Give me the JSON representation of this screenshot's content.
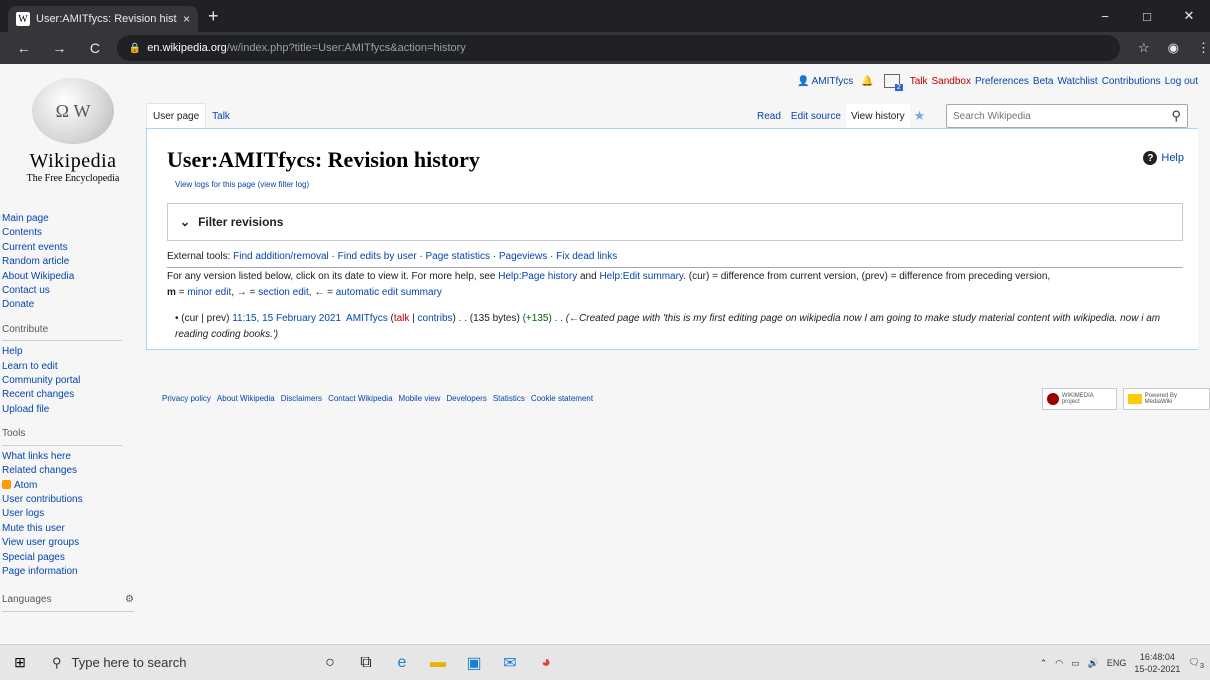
{
  "browser": {
    "tab_title": "User:AMITfycs: Revision history -",
    "tab_close": "×",
    "new_tab": "+",
    "url_host": "en.wikipedia.org",
    "url_path": "/w/index.php?title=User:AMITfycs&action=history",
    "win_minimize": "−",
    "win_restore": "□",
    "win_close": "✕"
  },
  "logo": {
    "wordmark": "Wikipedia",
    "tagline": "The Free Encyclopedia"
  },
  "personal": {
    "username": "AMITfycs",
    "notif_count": "2",
    "links": [
      "Talk",
      "Sandbox",
      "Preferences",
      "Beta",
      "Watchlist",
      "Contributions",
      "Log out"
    ]
  },
  "tabs": {
    "user_page": "User page",
    "talk": "Talk",
    "read": "Read",
    "edit_source": "Edit source",
    "view_history": "View history"
  },
  "search": {
    "placeholder": "Search Wikipedia"
  },
  "sidebar": {
    "nav": [
      "Main page",
      "Contents",
      "Current events",
      "Random article",
      "About Wikipedia",
      "Contact us",
      "Donate"
    ],
    "contribute_heading": "Contribute",
    "contribute": [
      "Help",
      "Learn to edit",
      "Community portal",
      "Recent changes",
      "Upload file"
    ],
    "tools_heading": "Tools",
    "tools": [
      "What links here",
      "Related changes",
      "Atom",
      "User contributions",
      "User logs",
      "Mute this user",
      "View user groups",
      "Special pages",
      "Page information"
    ],
    "languages": "Languages"
  },
  "content": {
    "title": "User:AMITfycs: Revision history",
    "help": "Help",
    "sub_links": "View logs for this page (view filter log)",
    "filter": "Filter revisions",
    "ext_label": "External tools:",
    "ext_tools": [
      "Find addition/removal",
      "Find edits by user",
      "Page statistics",
      "Pageviews",
      "Fix dead links"
    ],
    "info_1": "For any version listed below, click on its date to view it. For more help, see",
    "info_link1": "Help:Page history",
    "info_and": "and",
    "info_link2": "Help:Edit summary",
    "info_2": ". (cur) = difference from current version, (prev) = difference from preceding version,",
    "info_m": "m",
    "info_minor": "minor edit",
    "info_arrow": "→",
    "info_section": "section edit",
    "info_larrow": "←",
    "info_auto": "automatic edit summary",
    "rev": {
      "cur": "cur",
      "prev": "prev",
      "date": "11:15, 15 February 2021",
      "user": "AMITfycs",
      "talk": "talk",
      "contribs": "contribs",
      "bytes": "(135 bytes)",
      "delta": "(+135)",
      "comment": "(←Created page with 'this is my first editing page on wikipedia now I am going to make study material content with wikipedia. now i am reading coding books.')"
    }
  },
  "footer": {
    "links": [
      "Privacy policy",
      "About Wikipedia",
      "Disclaimers",
      "Contact Wikipedia",
      "Mobile view",
      "Developers",
      "Statistics",
      "Cookie statement"
    ],
    "badge1": "WIKIMEDIA project",
    "badge2": "Powered By MediaWiki"
  },
  "taskbar": {
    "search": "Type here to search",
    "lang": "ENG",
    "time": "16:48:04",
    "date": "15-02-2021",
    "notif": "3"
  }
}
